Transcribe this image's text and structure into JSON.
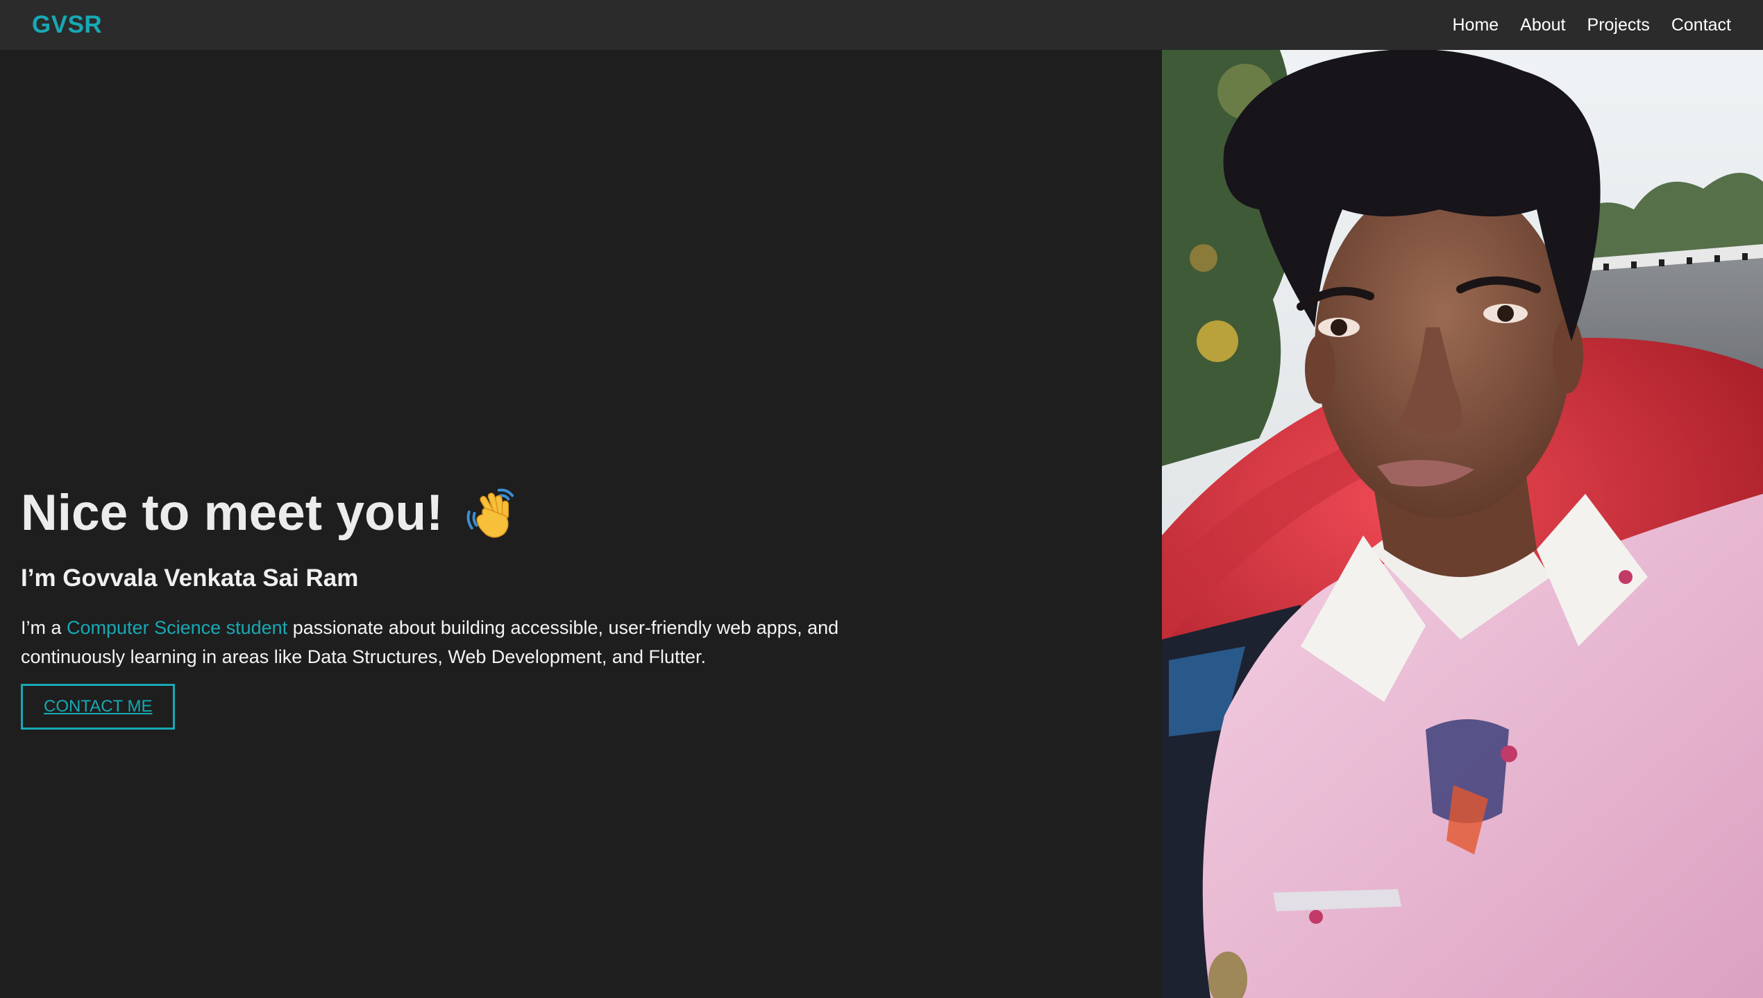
{
  "nav": {
    "brand": "GVSR",
    "links": [
      "Home",
      "About",
      "Projects",
      "Contact"
    ]
  },
  "hero": {
    "title": "Nice to meet you!",
    "wave_icon": "waving-hand-icon",
    "name": "I’m Govvala Venkata Sai Ram",
    "desc_prefix": "I’m a ",
    "desc_highlight": "Computer Science student",
    "desc_suffix": " passionate about building accessible, user-friendly web apps, and continuously learning in areas like Data Structures, Web Development, and Flutter.",
    "cta": "CONTACT ME"
  },
  "photo": {
    "subject": "profile-photo"
  },
  "colors": {
    "accent": "#17a9b5",
    "background": "#1e1e1e",
    "navbar": "#2b2b2b"
  }
}
